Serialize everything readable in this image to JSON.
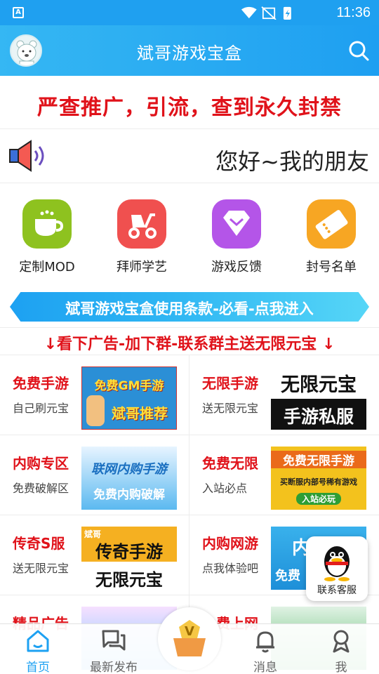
{
  "statusbar": {
    "time": "11:36"
  },
  "appbar": {
    "title": "斌哥游戏宝盒"
  },
  "notice": "严查推广，引流，查到永久封禁",
  "greeting": "您好~我的朋友",
  "quick_icons": [
    {
      "label": "定制MOD",
      "color": "#8ec21f",
      "icon": "cup-icon"
    },
    {
      "label": "拜师学艺",
      "color": "#f0504f",
      "icon": "scooter-icon"
    },
    {
      "label": "游戏反馈",
      "color": "#b455e8",
      "icon": "diamond-icon"
    },
    {
      "label": "封号名单",
      "color": "#f7a623",
      "icon": "ticket-icon"
    }
  ],
  "banner": "斌哥游戏宝盒使用条款-必看-点我进入",
  "ad_hint": "↓看下广告-加下群-联系群主送无限元宝 ↓",
  "grid": [
    {
      "title": "免费手游",
      "sub": "自己刷元宝",
      "thumb_lines": [
        "免费GM手游",
        "斌哥推荐"
      ]
    },
    {
      "title": "无限手游",
      "sub": "送无限元宝",
      "thumb_lines": [
        "无限元宝",
        "手游私服"
      ]
    },
    {
      "title": "内购专区",
      "sub": "免费破解区",
      "thumb_lines": [
        "联网内购手游",
        "免费内购破解"
      ]
    },
    {
      "title": "免费无限",
      "sub": "入站必点",
      "thumb_lines": [
        "免费无限手游",
        "买断服内部号稀有游戏",
        "入站必玩"
      ]
    },
    {
      "title": "传奇S服",
      "sub": "送无限元宝",
      "thumb_lines": [
        "斌哥",
        "传奇手游",
        "无限元宝"
      ]
    },
    {
      "title": "内购网游",
      "sub": "点我体验吧",
      "thumb_lines": [
        "内",
        "免费"
      ]
    },
    {
      "title": "精品广告",
      "sub": "",
      "thumb_lines": []
    },
    {
      "title": "免费上网",
      "sub": "",
      "thumb_lines": []
    }
  ],
  "qq_service": "联系客服",
  "tabs": [
    {
      "label": "首页",
      "icon": "home-icon"
    },
    {
      "label": "最新发布",
      "icon": "chat-icon"
    },
    {
      "label": "消息",
      "icon": "bell-icon"
    },
    {
      "label": "我",
      "icon": "user-icon"
    }
  ],
  "colors": {
    "accent": "#1da1f2",
    "alert": "#e0121a"
  }
}
